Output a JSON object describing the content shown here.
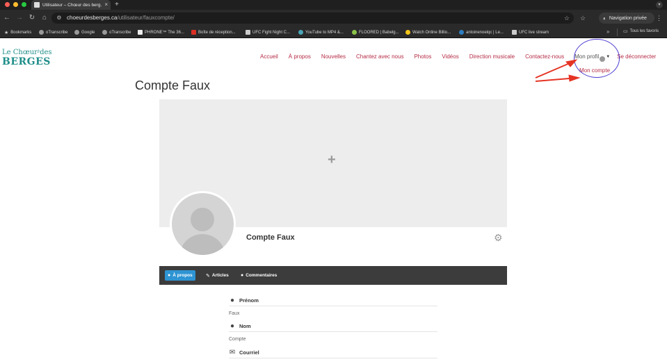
{
  "browser": {
    "tab_title": "Utilisateur – Chœur des berg...",
    "tab_close": "×",
    "new_tab": "+",
    "url_domain": "choeurdesberges.ca",
    "url_path": "/utilisateur/fauxcompte/",
    "incognito_label": "Navigation privée",
    "bookmarks": [
      {
        "label": "Bookmarks"
      },
      {
        "label": "oTranscribe"
      },
      {
        "label": "Google"
      },
      {
        "label": "oTranscribe"
      },
      {
        "label": "PHRONE™ The 36..."
      },
      {
        "label": "Boîte de réception..."
      },
      {
        "label": "UFC Fight Night C..."
      },
      {
        "label": "YouTube to MP4 &..."
      },
      {
        "label": "FLOORED | Babelg..."
      },
      {
        "label": "Watch Online Billio..."
      },
      {
        "label": "antoinenoelqc | Le..."
      },
      {
        "label": "UFC live stream"
      }
    ],
    "bookmarks_more": "»",
    "all_bookmarks": "Tous les favoris"
  },
  "site": {
    "logo_top": "Le Chœur des",
    "logo_bottom": "BERGES",
    "nav": [
      {
        "label": "Accueil"
      },
      {
        "label": "À propos"
      },
      {
        "label": "Nouvelles"
      },
      {
        "label": "Chantez avec nous"
      },
      {
        "label": "Photos"
      },
      {
        "label": "Vidéos"
      },
      {
        "label": "Direction musicale"
      },
      {
        "label": "Contactez-nous"
      }
    ],
    "profile_menu": "Mon profil",
    "logout": "Se déconnecter",
    "submenu_item": "Mon compte"
  },
  "page": {
    "title": "Compte Faux",
    "cover_add": "+",
    "profile_name": "Compte Faux",
    "tabs": [
      {
        "label": "À propos",
        "active": true
      },
      {
        "label": "Articles",
        "active": false
      },
      {
        "label": "Commentaires",
        "active": false
      }
    ],
    "fields": [
      {
        "label": "Prénom",
        "value": "Faux"
      },
      {
        "label": "Nom",
        "value": "Compte"
      },
      {
        "label": "Courriel",
        "value": ""
      }
    ]
  },
  "colors": {
    "brand_teal": "#1f8e8a",
    "nav_link": "#b52b45",
    "tab_active": "#2e94d3",
    "annotation_arrow": "#e53424",
    "cursor_ring": "#4b3bd1"
  },
  "icons": {
    "back": "arrow-left-icon",
    "forward": "arrow-right-icon",
    "reload": "reload-icon",
    "home": "home-icon",
    "settings": "gear-icon",
    "user": "user-icon",
    "mail": "envelope-icon",
    "edit": "pencil-icon",
    "comment": "comment-icon"
  }
}
